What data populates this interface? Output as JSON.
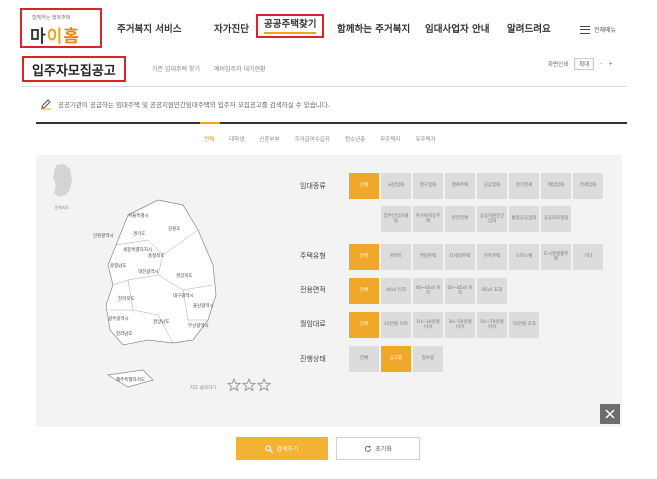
{
  "logo": {
    "tagline": "함께하는 행복주택",
    "name_part1": "마",
    "name_part2": "이",
    "name_part3": "홈"
  },
  "gnb": [
    {
      "label": "주거복지 서비스"
    },
    {
      "label": "자가진단"
    },
    {
      "label": "공공주택찾기"
    },
    {
      "label": "함께하는 주거복지"
    },
    {
      "label": "임대사업자 안내"
    },
    {
      "label": "알려드려요"
    }
  ],
  "menu_all_label": "전체메뉴",
  "page": {
    "title": "입주자모집공고",
    "breadcrumb": [
      "기존 임대주택 찾기",
      "예비입주자 대기현황"
    ],
    "tools": {
      "share": "화면인쇄",
      "font": "확대",
      "minus": "-",
      "plus": "+"
    },
    "intro": "공공기관이 공급하는 임대주택 및 공공지원민간임대주택의 입주자 모집공고를 검색하실 수 있습니다."
  },
  "tabs": [
    "전체",
    "대학생",
    "신혼부부",
    "주거급여수급자",
    "청소년층",
    "무주택자",
    "유주택자"
  ],
  "map": {
    "mini_label": "전체지도",
    "regions": [
      "서울특별시",
      "경기도",
      "인천광역시",
      "강원도",
      "충청북도",
      "세종특별자치시",
      "충청남도",
      "대전광역시",
      "경상북도",
      "대구광역시",
      "전라북도",
      "광주광역시",
      "전라남도",
      "경상남도",
      "울산광역시",
      "부산광역시",
      "제주특별자치도"
    ],
    "note": "지도 클릭하기"
  },
  "filters": {
    "rental_type": {
      "label": "임대종류",
      "options": [
        "전체",
        "국민임대",
        "영구임대",
        "행복주택",
        "공공임대",
        "장기전세",
        "매입임대",
        "전세임대",
        "집주인리모델링",
        "주거복지동주택",
        "분양전환",
        "공공지원민간임대",
        "통합공공임대",
        "공공리모델링"
      ]
    },
    "house_type": {
      "label": "주택유형",
      "options": [
        "전체",
        "아파트",
        "연립주택",
        "다세대주택",
        "단독주택",
        "오피스텔",
        "도시형생활주택",
        "기타"
      ]
    },
    "area": {
      "label": "전용면적",
      "options": [
        "전체",
        "40㎡ 이하",
        "40~60㎡ 이하",
        "60~85㎡ 이하",
        "85㎡ 초과"
      ]
    },
    "rent": {
      "label": "월임대료",
      "options": [
        "전체",
        "10만원 이하",
        "10~30만원 이하",
        "30~50만원 이하",
        "50~70만원 이하",
        "70만원 초과"
      ]
    },
    "status": {
      "label": "진행상태",
      "options": [
        "전체",
        "공고중",
        "접수중"
      ]
    }
  },
  "buttons": {
    "search": "검색하기",
    "reset": "초기화"
  }
}
